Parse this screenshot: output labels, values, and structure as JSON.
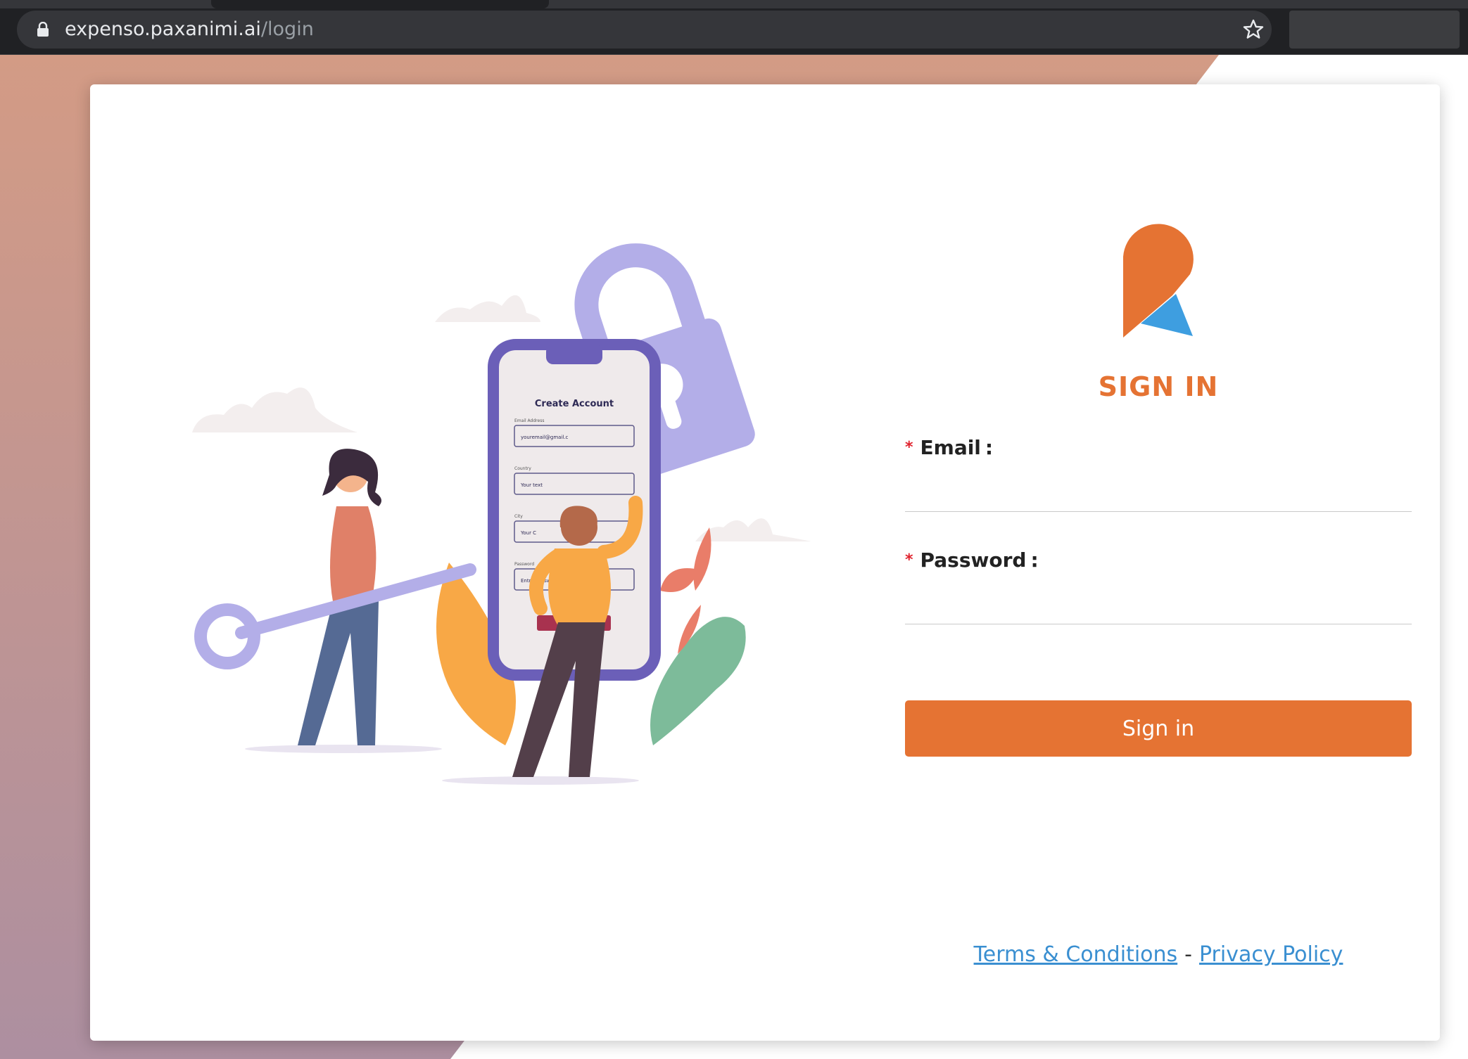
{
  "browser": {
    "url_host": "expenso.paxanimi.ai",
    "url_path": "/login",
    "icons": {
      "lock": "lock-icon",
      "bookmark": "star-icon"
    }
  },
  "illustration": {
    "form_title": "Create Account",
    "fields": [
      {
        "label": "Email Address",
        "value": "youremail@gmail.c"
      },
      {
        "label": "Country",
        "value": "Your text"
      },
      {
        "label": "City",
        "value": "Your C"
      },
      {
        "label": "Password",
        "value": "Entry password"
      }
    ]
  },
  "login": {
    "title": "SIGN IN",
    "required_marker": "*",
    "email_label": "Email",
    "password_label": "Password",
    "colon": ":",
    "email_value": "",
    "password_value": "",
    "signin_label": "Sign in"
  },
  "footer": {
    "terms": "Terms & Conditions",
    "separator": "-",
    "privacy": "Privacy Policy"
  },
  "colors": {
    "accent": "#e57333",
    "logo_blue": "#3e9ee0",
    "link": "#3a8fd1",
    "required": "#e0242f",
    "bg_gradient_top": "#d39b85",
    "bg_gradient_bottom": "#ad8fa0"
  }
}
